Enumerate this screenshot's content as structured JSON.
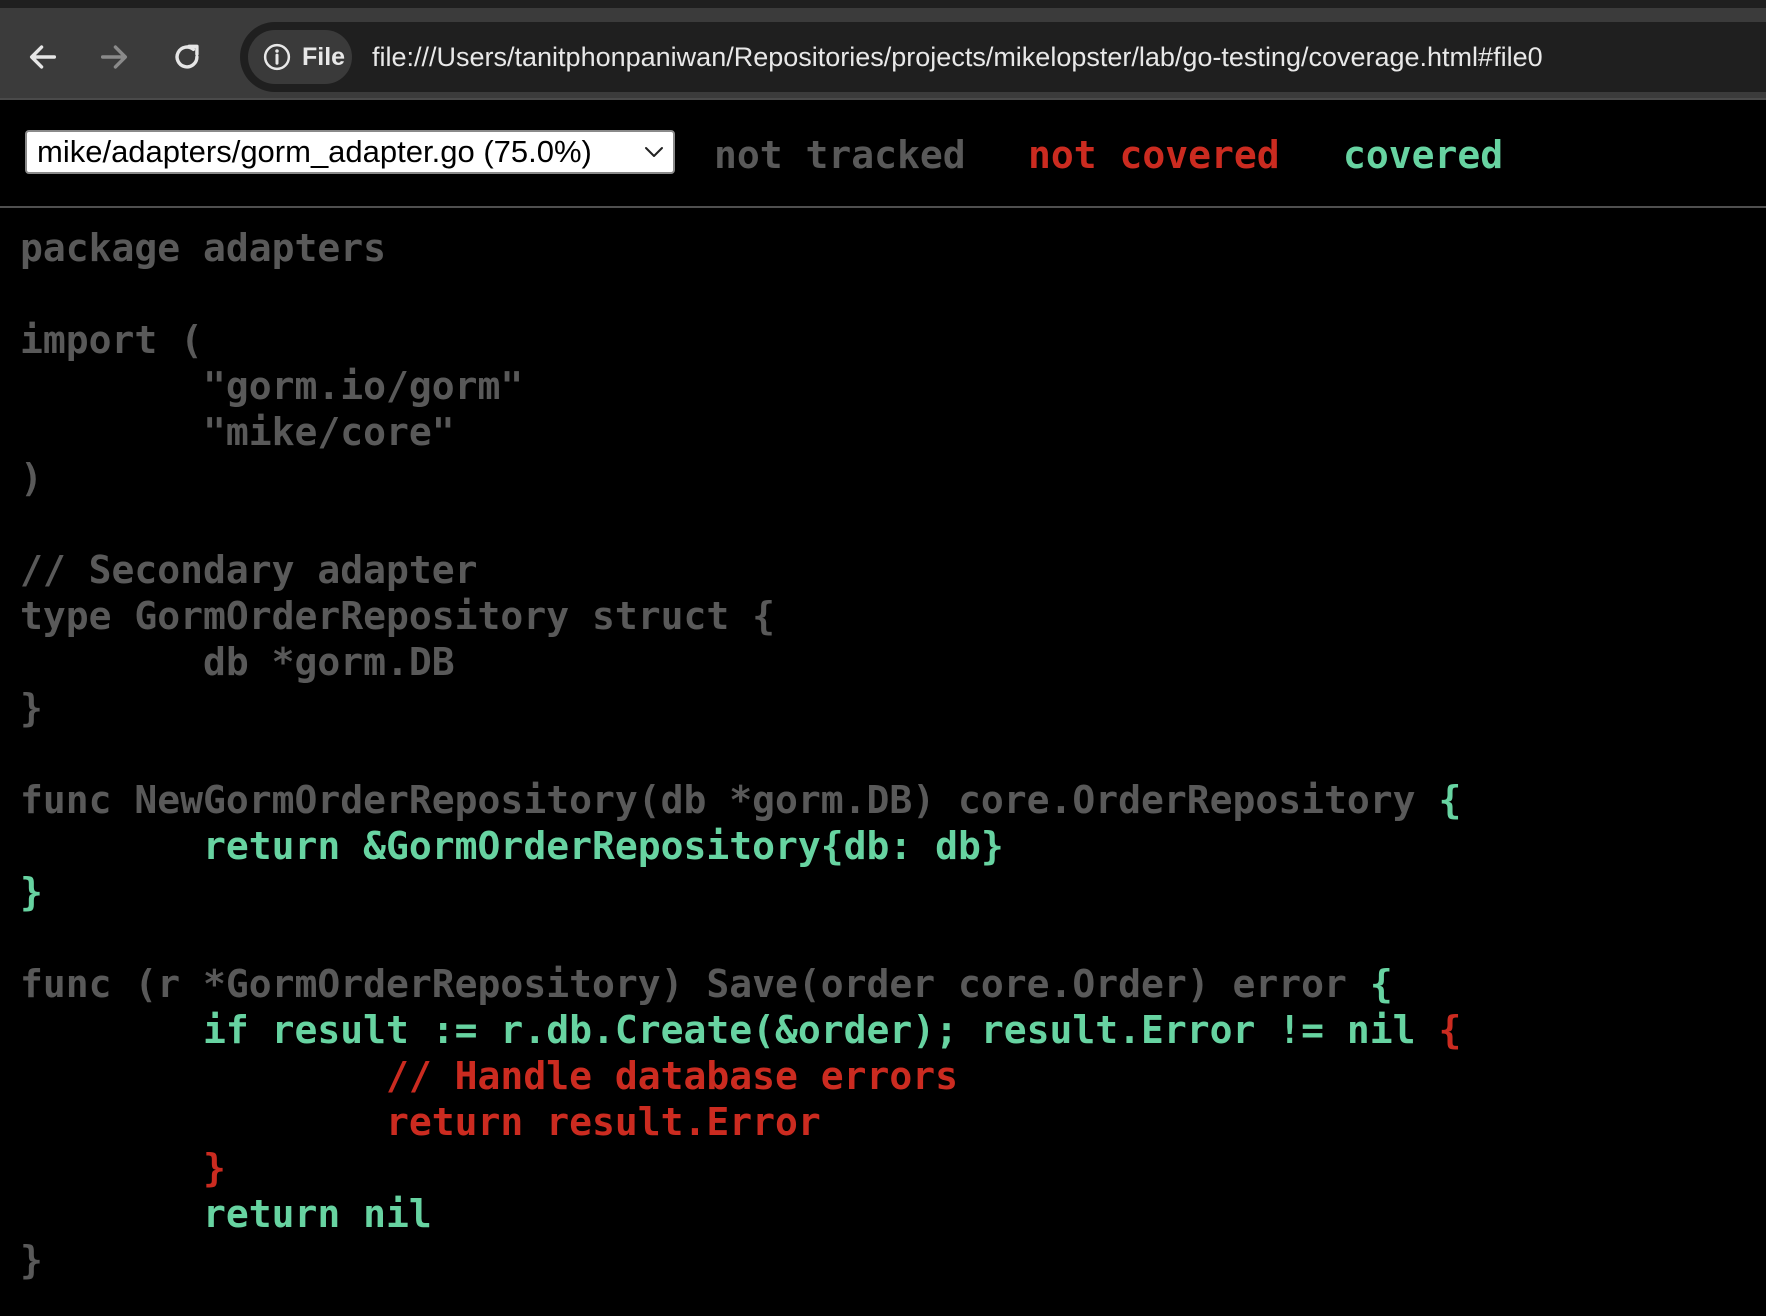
{
  "browser": {
    "site_chip_label": "File",
    "url": "file:///Users/tanitphonpaniwan/Repositories/projects/mikelopster/lab/go-testing/coverage.html#file0",
    "icons": {
      "back": "arrow-left-icon",
      "forward": "arrow-right-icon",
      "reload": "reload-icon",
      "info": "info-icon"
    }
  },
  "topbar": {
    "file_select_value": "mike/adapters/gorm_adapter.go (75.0%)",
    "legend": {
      "not_tracked": "not tracked",
      "not_covered": "not covered",
      "covered": "covered"
    }
  },
  "colors": {
    "not_tracked": "#595959",
    "not_covered": "#cb2b20",
    "covered": "#67d3a1",
    "background": "#000000"
  },
  "code": {
    "lines": [
      [
        {
          "t": "package adapters",
          "s": 0
        }
      ],
      [
        {
          "t": "",
          "s": 0
        }
      ],
      [
        {
          "t": "import (",
          "s": 0
        }
      ],
      [
        {
          "t": "        \"gorm.io/gorm\"",
          "s": 0
        }
      ],
      [
        {
          "t": "        \"mike/core\"",
          "s": 0
        }
      ],
      [
        {
          "t": ")",
          "s": 0
        }
      ],
      [
        {
          "t": "",
          "s": 0
        }
      ],
      [
        {
          "t": "// Secondary adapter",
          "s": 0
        }
      ],
      [
        {
          "t": "type GormOrderRepository struct {",
          "s": 0
        }
      ],
      [
        {
          "t": "        db *gorm.DB",
          "s": 0
        }
      ],
      [
        {
          "t": "}",
          "s": 0
        }
      ],
      [
        {
          "t": "",
          "s": 0
        }
      ],
      [
        {
          "t": "func NewGormOrderRepository(db *gorm.DB) core.OrderRepository ",
          "s": 0
        },
        {
          "t": "{",
          "s": 2
        }
      ],
      [
        {
          "t": "        return &GormOrderRepository{db: db}",
          "s": 2
        }
      ],
      [
        {
          "t": "}",
          "s": 2
        }
      ],
      [
        {
          "t": "",
          "s": 0
        }
      ],
      [
        {
          "t": "func (r *GormOrderRepository) Save(order core.Order) error ",
          "s": 0
        },
        {
          "t": "{",
          "s": 2
        }
      ],
      [
        {
          "t": "        if result := r.db.Create(&order); result.Error != nil ",
          "s": 2
        },
        {
          "t": "{",
          "s": 1
        }
      ],
      [
        {
          "t": "                // Handle database errors",
          "s": 1
        }
      ],
      [
        {
          "t": "                return result.Error",
          "s": 1
        }
      ],
      [
        {
          "t": "        }",
          "s": 1
        }
      ],
      [
        {
          "t": "        return nil",
          "s": 2
        }
      ],
      [
        {
          "t": "}",
          "s": 0
        }
      ]
    ]
  }
}
